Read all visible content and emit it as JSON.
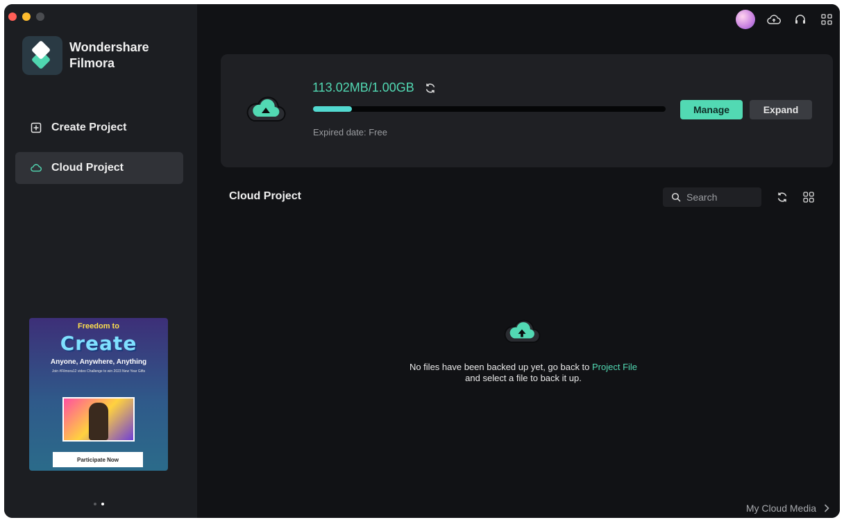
{
  "app": {
    "brand_name": "Wondershare Filmora"
  },
  "sidebar": {
    "items": [
      {
        "label": "Create Project",
        "icon": "plus-square-icon",
        "active": false
      },
      {
        "label": "Cloud Project",
        "icon": "cloud-icon",
        "active": true
      }
    ],
    "promo": {
      "line1": "Freedom to",
      "headline": "Create",
      "tagline": "Anyone, Anywhere, Anything",
      "small_text": "Join #Filmora12 video Challenge to win 2023 New Year Gifts",
      "cta_label": "Participate Now"
    },
    "pager": {
      "count": 2,
      "active_index": 1
    }
  },
  "topbar": {
    "icons": [
      "avatar",
      "cloud-upload-icon",
      "headset-icon",
      "apps-grid-icon"
    ]
  },
  "storage": {
    "usage_text": "113.02MB/1.00GB",
    "used_fraction": 0.11,
    "expired_text": "Expired date: Free",
    "manage_label": "Manage",
    "expand_label": "Expand"
  },
  "cloud_project": {
    "title": "Cloud Project",
    "search_placeholder": "Search",
    "empty_line1_prefix": "No files have been backed up yet, go back to ",
    "empty_link": "Project File",
    "empty_line2": "and select a file to back it up."
  },
  "footer": {
    "my_cloud_media_label": "My Cloud Media"
  },
  "colors": {
    "accent": "#52d9b3",
    "bar_fill": "#52d9d0",
    "background": "#111215",
    "sidebar": "#1c1e22",
    "panel": "#1f2024"
  }
}
